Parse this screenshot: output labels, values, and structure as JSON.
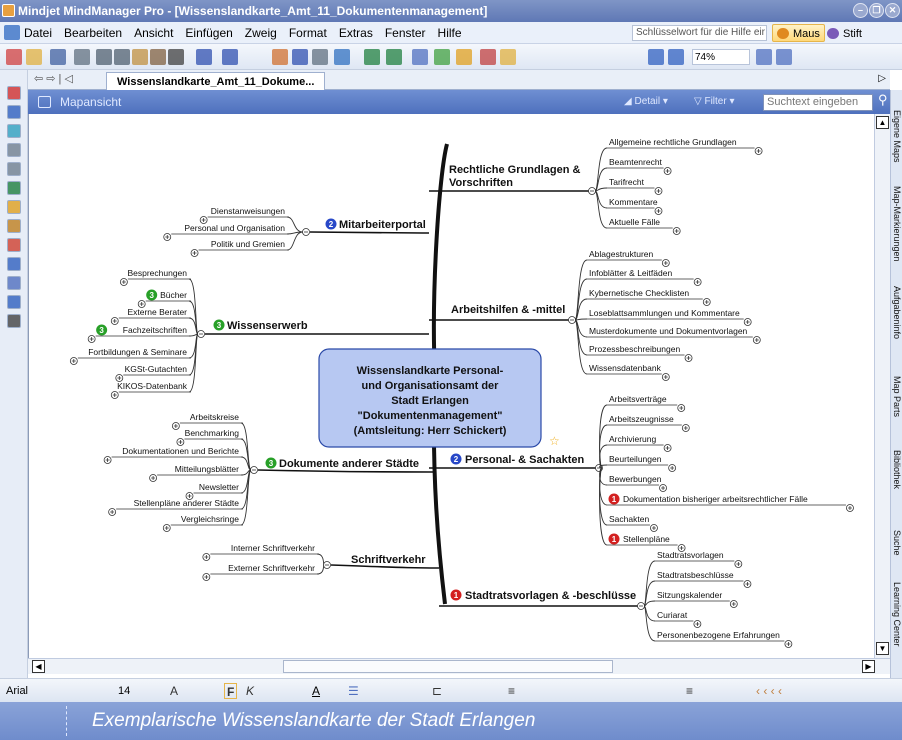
{
  "window": {
    "title": "Mindjet MindManager Pro - [Wissenslandkarte_Amt_11_Dokumentenmanagement]"
  },
  "menubar": {
    "items": [
      "Datei",
      "Bearbeiten",
      "Ansicht",
      "Einfügen",
      "Zweig",
      "Format",
      "Extras",
      "Fenster",
      "Hilfe"
    ],
    "help_placeholder": "Schlüsselwort für die Hilfe eir",
    "mode_maus": "Maus",
    "mode_stift": "Stift"
  },
  "toolbar": {
    "zoom": "74%"
  },
  "tabs": {
    "document": "Wissenslandkarte_Amt_11_Dokume..."
  },
  "mapbar": {
    "view_label": "Mapansicht",
    "detail": "Detail",
    "filter": "Filter",
    "search_placeholder": "Suchtext eingeben"
  },
  "right_panel": {
    "items": [
      "Eigene Maps",
      "Map-Markierungen",
      "Aufgabeninfo",
      "Map Parts",
      "Bibliothek",
      "Suche",
      "Learning Center"
    ]
  },
  "format": {
    "font": "Arial",
    "size": "14"
  },
  "caption": "Exemplarische Wissenslandkarte der Stadt Erlangen",
  "colors": {
    "accent": "#4e70bd",
    "central_fill": "#b7c8f2",
    "priority1": "#d32020",
    "priority2": "#2848c8",
    "priority3": "#28a028"
  },
  "map": {
    "central": [
      "Wissenslandkarte Personal-",
      "und Organisationsamt der",
      "Stadt Erlangen",
      "\"Dokumentenmanagement\"",
      "(Amtsleitung: Herr Schickert)"
    ],
    "right": [
      {
        "label": [
          "Rechtliche Grundlagen &",
          "Vorschriften"
        ],
        "subs": [
          "Allgemeine rechtliche Grundlagen",
          "Beamtenrecht",
          "Tarifrecht",
          "Kommentare",
          "Aktuelle Fälle"
        ]
      },
      {
        "label": [
          "Arbeitshilfen & -mittel"
        ],
        "subs": [
          "Ablagestrukturen",
          "Infoblätter & Leitfäden",
          "Kybernetische Checklisten",
          "Loseblattsammlungen und Kommentare",
          "Musterdokumente und Dokumentvorlagen",
          "Prozessbeschreibungen",
          "Wissensdatenbank"
        ]
      },
      {
        "priority": "2",
        "label": [
          "Personal- & Sachakten"
        ],
        "subs": [
          "Arbeitsverträge",
          "Arbeitszeugnisse",
          "Archivierung",
          "Beurteilungen",
          "Bewerbungen",
          "Dokumentation bisheriger arbeitsrechtlicher Fälle",
          "Sachakten",
          "Stellenpläne"
        ],
        "sub_priorities": {
          "5": "1",
          "7": "1"
        }
      },
      {
        "priority": "1",
        "label": [
          "Stadtratsvorlagen & -beschlüsse"
        ],
        "subs": [
          "Stadtratsvorlagen",
          "Stadtratsbeschlüsse",
          "Sitzungskalender",
          "Curiarat",
          "Personenbezogene Erfahrungen"
        ]
      }
    ],
    "left": [
      {
        "priority": "2",
        "label": "Mitarbeiterportal",
        "subs": [
          "Dienstanweisungen",
          "Personal und Organisation",
          "Politik und Gremien"
        ]
      },
      {
        "priority": "3",
        "label": "Wissenserwerb",
        "subs": [
          "Besprechungen",
          "Bücher",
          "Externe Berater",
          "Fachzeitschriften",
          "Fortbildungen & Seminare",
          "KGSt-Gutachten",
          "KIKOS-Datenbank"
        ],
        "sub_priorities": {
          "1": "3",
          "3": "3"
        }
      },
      {
        "priority": "3",
        "label": "Dokumente anderer Städte",
        "subs": [
          "Arbeitskreise",
          "Benchmarking",
          "Dokumentationen und Berichte",
          "Mitteilungsblätter",
          "Newsletter",
          "Stellenpläne anderer Städte",
          "Vergleichsringe"
        ]
      },
      {
        "label": "Schriftverkehr",
        "subs": [
          "Interner Schriftverkehr",
          "Externer Schriftverkehr"
        ]
      }
    ]
  }
}
